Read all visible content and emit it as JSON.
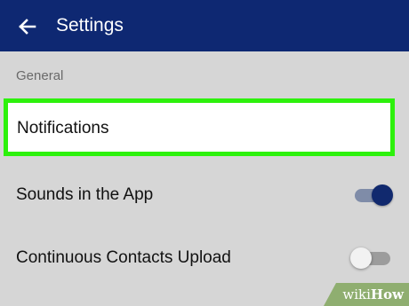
{
  "header": {
    "back_icon": "arrow-left-icon",
    "title": "Settings",
    "background_color": "#0e2872"
  },
  "section": {
    "label": "General"
  },
  "items": [
    {
      "label": "Notifications",
      "highlighted": true,
      "highlight_color": "#2df10c"
    },
    {
      "label": "Sounds in the App",
      "toggle": true,
      "toggle_on": true
    },
    {
      "label": "Continuous Contacts Upload",
      "toggle": true,
      "toggle_on": false
    }
  ],
  "colors": {
    "background": "#d6d6d6",
    "accent": "#11296e"
  },
  "watermark": {
    "text_light": "wiki",
    "text_bold": "How"
  }
}
